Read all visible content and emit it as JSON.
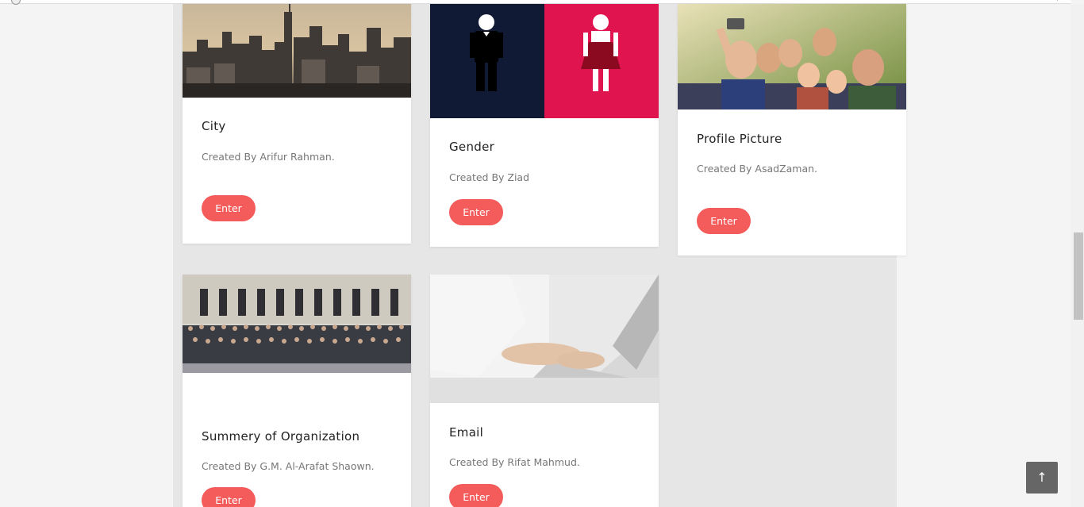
{
  "cards": [
    {
      "title": "City",
      "byline": "Created By Arifur Rahman.",
      "button": "Enter",
      "image": "city-skyline-image"
    },
    {
      "title": "Gender",
      "byline": "Created By Ziad",
      "button": "Enter",
      "image": "gender-icons-image"
    },
    {
      "title": "Profile Picture",
      "byline": "Created By AsadZaman.",
      "button": "Enter",
      "image": "family-selfie-image"
    },
    {
      "title": "Summery of Organization",
      "byline": "Created By G.M. Al-Arafat Shaown.",
      "button": "Enter",
      "image": "organization-group-photo-image"
    },
    {
      "title": "Email",
      "byline": "Created By Rifat Mahmud.",
      "button": "Enter",
      "image": "laptop-typing-image"
    }
  ],
  "back_to_top": {
    "icon": "arrow-up-icon",
    "glyph": "↑"
  },
  "colors": {
    "accent": "#f45b5b",
    "page_bg": "#f4f4f4",
    "content_bg": "#e6e6e6"
  }
}
